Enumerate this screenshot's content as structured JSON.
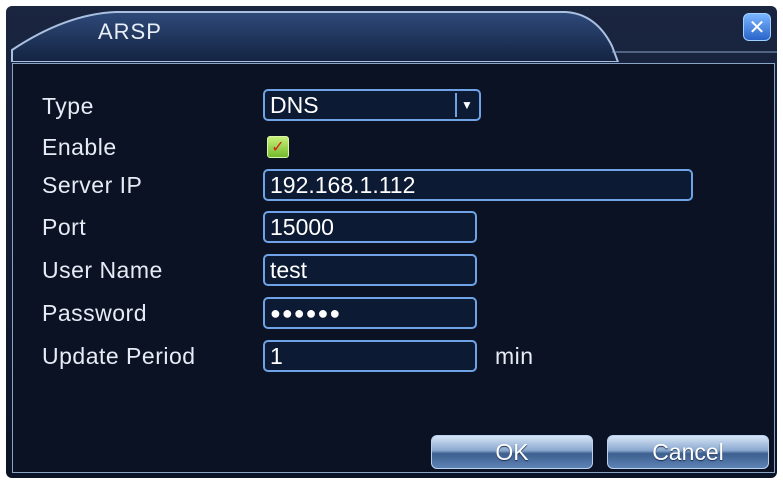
{
  "window": {
    "title": "ARSP",
    "close_icon": "close-icon"
  },
  "form": {
    "type": {
      "label": "Type",
      "value": "DNS"
    },
    "enable": {
      "label": "Enable",
      "checked": true
    },
    "server_ip": {
      "label": "Server IP",
      "value": "192.168.1.112"
    },
    "port": {
      "label": "Port",
      "value": "15000"
    },
    "user_name": {
      "label": "User Name",
      "value": "test"
    },
    "password": {
      "label": "Password",
      "value": "●●●●●●"
    },
    "update_period": {
      "label": "Update Period",
      "value": "1",
      "unit": "min"
    }
  },
  "buttons": {
    "ok": "OK",
    "cancel": "Cancel"
  },
  "colors": {
    "background": "#0a1224",
    "field_border": "#6fa3e6",
    "checkbox_fill": "#8cc63f",
    "check_mark": "#d62020"
  }
}
